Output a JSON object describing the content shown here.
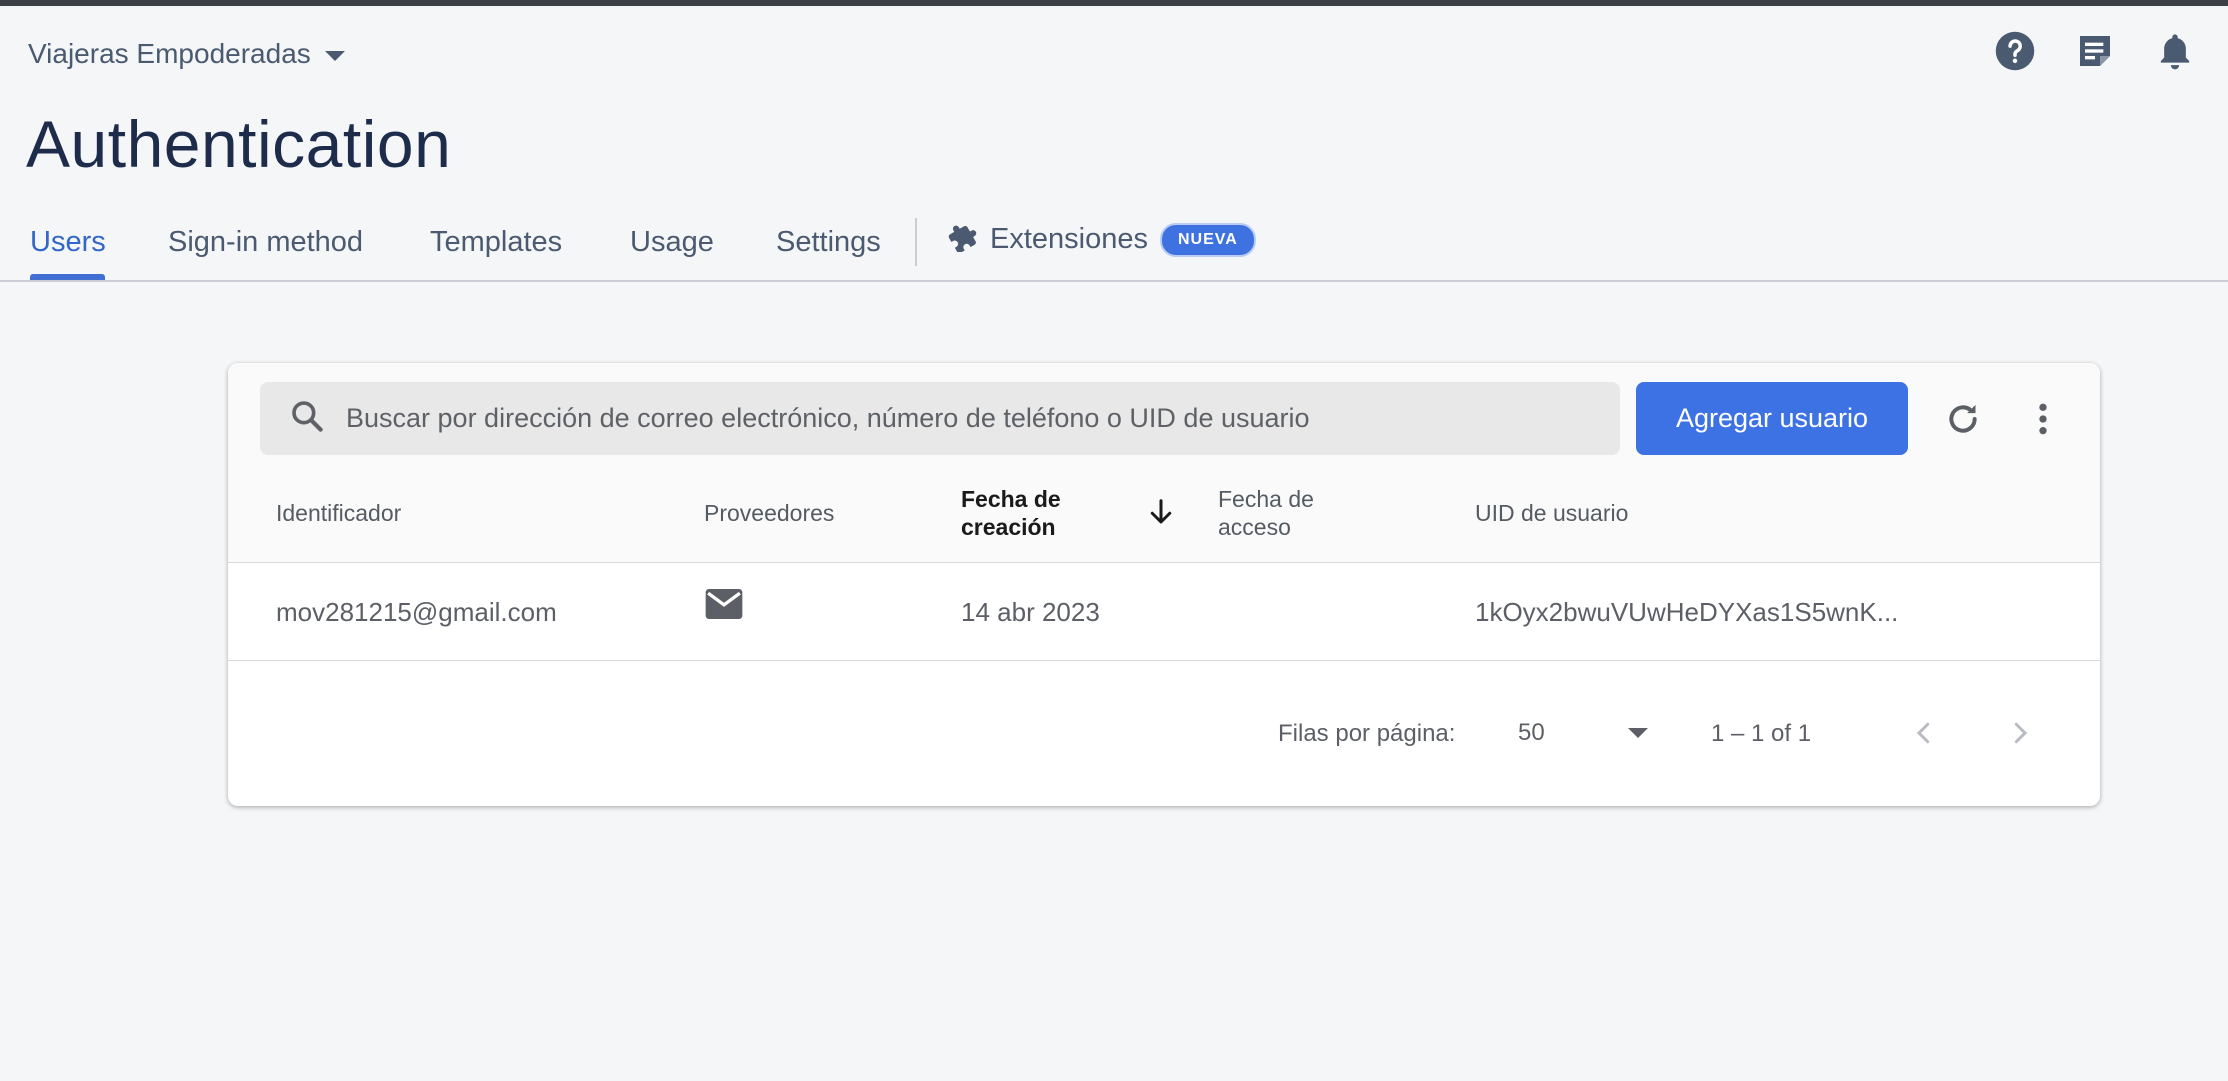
{
  "header": {
    "project_name": "Viajeras Empoderadas",
    "icons": [
      "help-icon",
      "release-notes-icon",
      "notifications-icon"
    ]
  },
  "page": {
    "title": "Authentication"
  },
  "tabs": {
    "items": [
      {
        "label": "Users",
        "active": true
      },
      {
        "label": "Sign-in method"
      },
      {
        "label": "Templates"
      },
      {
        "label": "Usage"
      },
      {
        "label": "Settings"
      }
    ],
    "extensions": {
      "label": "Extensiones",
      "badge": "NUEVA",
      "icon": "puzzle-icon"
    }
  },
  "toolbar": {
    "search_placeholder": "Buscar por dirección de correo electrónico, número de teléfono o UID de usuario",
    "add_user_label": "Agregar usuario"
  },
  "table": {
    "columns": [
      "Identificador",
      "Proveedores",
      "Fecha de creación",
      "Fecha de acceso",
      "UID de usuario"
    ],
    "sorted_column": "Fecha de creación",
    "sort_direction": "descending",
    "rows": [
      {
        "identifier": "mov281215@gmail.com",
        "provider_icon": "email-icon",
        "created": "14 abr 2023",
        "last_signin": "",
        "uid": "1kOyx2bwuVUwHeDYXas1S5wnK..."
      }
    ]
  },
  "pagination": {
    "rows_per_page_label": "Filas por página:",
    "rows_per_page": "50",
    "range": "1 – 1 of 1"
  },
  "colors": {
    "accent": "#3c72e4",
    "active_tab": "#3366c9",
    "title": "#1d2c4a"
  }
}
